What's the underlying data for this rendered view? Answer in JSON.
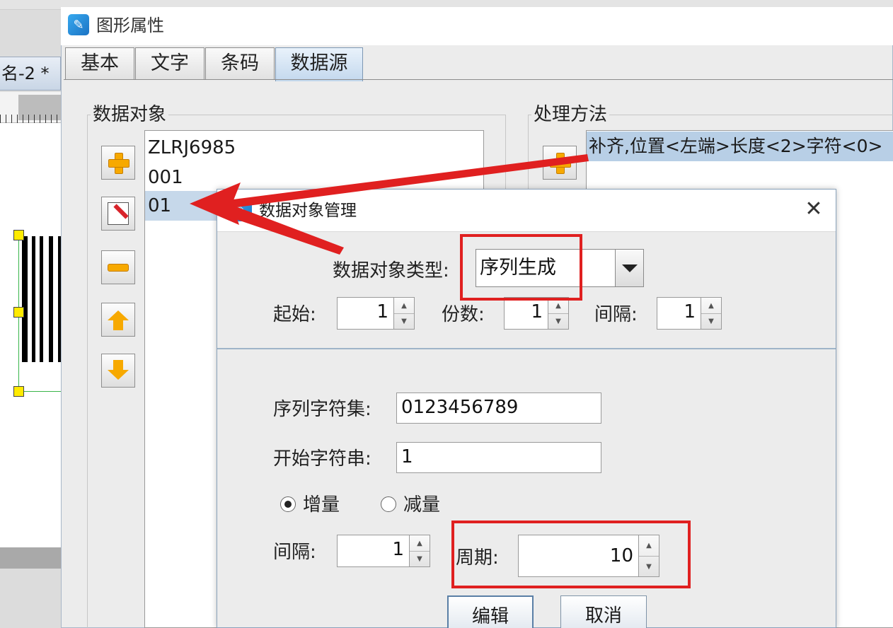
{
  "background": {
    "doc_tab_label": "名-2 *"
  },
  "main_dialog": {
    "title": "图形属性",
    "tabs": [
      {
        "label": "基本"
      },
      {
        "label": "文字"
      },
      {
        "label": "条码"
      },
      {
        "label": "数据源"
      }
    ],
    "active_tab": "数据源",
    "data_objects": {
      "group_title": "数据对象",
      "items": [
        "ZLRJ6985",
        "001",
        "01"
      ],
      "selected": "01"
    },
    "processing": {
      "group_title": "处理方法",
      "items": [
        "补齐,位置<左端>长度<2>字符<0>"
      ]
    }
  },
  "dom_dialog": {
    "title": "数据对象管理",
    "close_glyph": "✕",
    "type_label": "数据对象类型:",
    "type_value": "序列生成",
    "start_label": "起始:",
    "start_value": "1",
    "copies_label": "份数:",
    "copies_value": "1",
    "interval_label": "间隔:",
    "interval_value": "1",
    "charset_label": "序列字符集:",
    "charset_value": "0123456789",
    "start_string_label": "开始字符串:",
    "start_string_value": "1",
    "increment_label": "增量",
    "decrement_label": "减量",
    "mode": "increment",
    "step_interval_label": "间隔:",
    "step_interval_value": "1",
    "period_label": "周期:",
    "period_value": "10",
    "edit_button": "编辑",
    "cancel_button": "取消"
  },
  "colors": {
    "annotation_red": "#e02020",
    "selection_blue": "#c6d8ea",
    "accent_orange": "#f7a900"
  }
}
